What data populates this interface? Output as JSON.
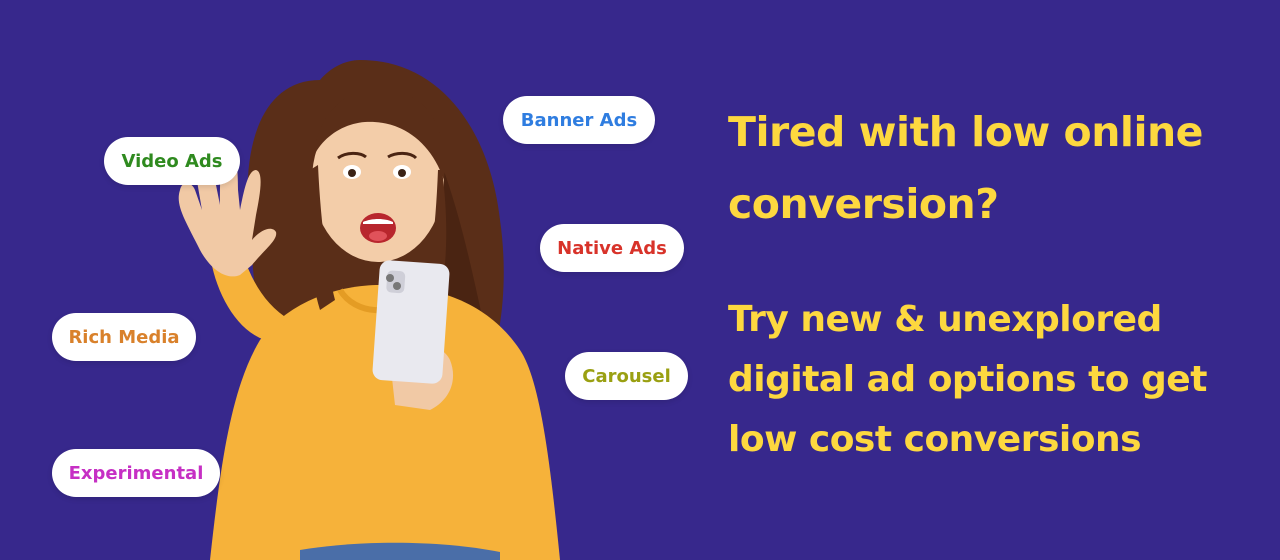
{
  "colors": {
    "background": "#37288c",
    "headline": "#fdd83f",
    "pill_background": "#ffffff"
  },
  "tags": {
    "banner_ads": {
      "label": "Banner Ads",
      "color": "#2f7de0"
    },
    "video_ads": {
      "label": "Video Ads",
      "color": "#2f8a1f"
    },
    "native_ads": {
      "label": "Native Ads",
      "color": "#d8332a"
    },
    "rich_media": {
      "label": "Rich Media",
      "color": "#d9812b"
    },
    "carousel": {
      "label": "Carousel",
      "color": "#9aa012"
    },
    "experimental": {
      "label": "Experimental",
      "color": "#c62fc4"
    }
  },
  "headline": {
    "line1": "Tired with low online",
    "line2": "conversion?"
  },
  "subline": {
    "line1": "Try new & unexplored",
    "line2": "digital ad options to get",
    "line3": "low cost conversions"
  }
}
